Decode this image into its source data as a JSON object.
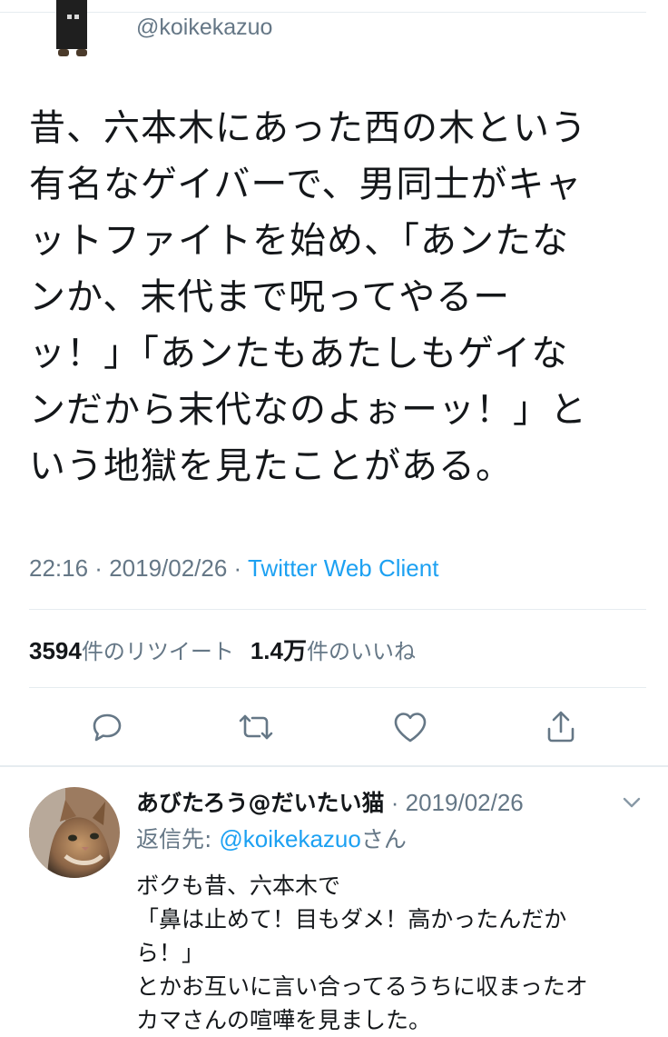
{
  "tweet": {
    "handle": "@koikekazuo",
    "text_lines": [
      "昔、六本木にあった西の木という",
      "有名なゲイバーで、男同士がキャ",
      "ットファイトを始め、「あンたな",
      "ンか、末代まで呪ってやるー",
      "ッ！」「あンたもあたしもゲイな",
      "ンだから末代なのよぉーッ！」と",
      "いう地獄を見たことがある。"
    ],
    "time": "22:16",
    "sep1": " · ",
    "date": "2019/02/26",
    "sep2": " · ",
    "client": "Twitter Web Client",
    "retweet_count": "3594",
    "retweet_label": "件のリツイート",
    "like_count": "1.4万",
    "like_label": "件のいいね"
  },
  "actions": {
    "reply": "reply-icon",
    "retweet": "retweet-icon",
    "like": "heart-icon",
    "share": "share-icon"
  },
  "reply": {
    "name": "あびたろう@だいたい猫",
    "sep": " · ",
    "date": "2019/02/26",
    "reply_to_label": "返信先: ",
    "reply_to_handle": "@koikekazuo",
    "reply_to_suffix": "さん",
    "text_lines": [
      "ボクも昔、六本木で",
      "「鼻は止めて！目もダメ！高かったんだか",
      "ら！」",
      "とかお互いに言い合ってるうちに収まったオ",
      "カマさんの喧嘩を見ました。"
    ]
  },
  "colors": {
    "link": "#1da1f2",
    "secondary_text": "#657786",
    "icon": "#657786",
    "divider": "#e6ecf0"
  }
}
